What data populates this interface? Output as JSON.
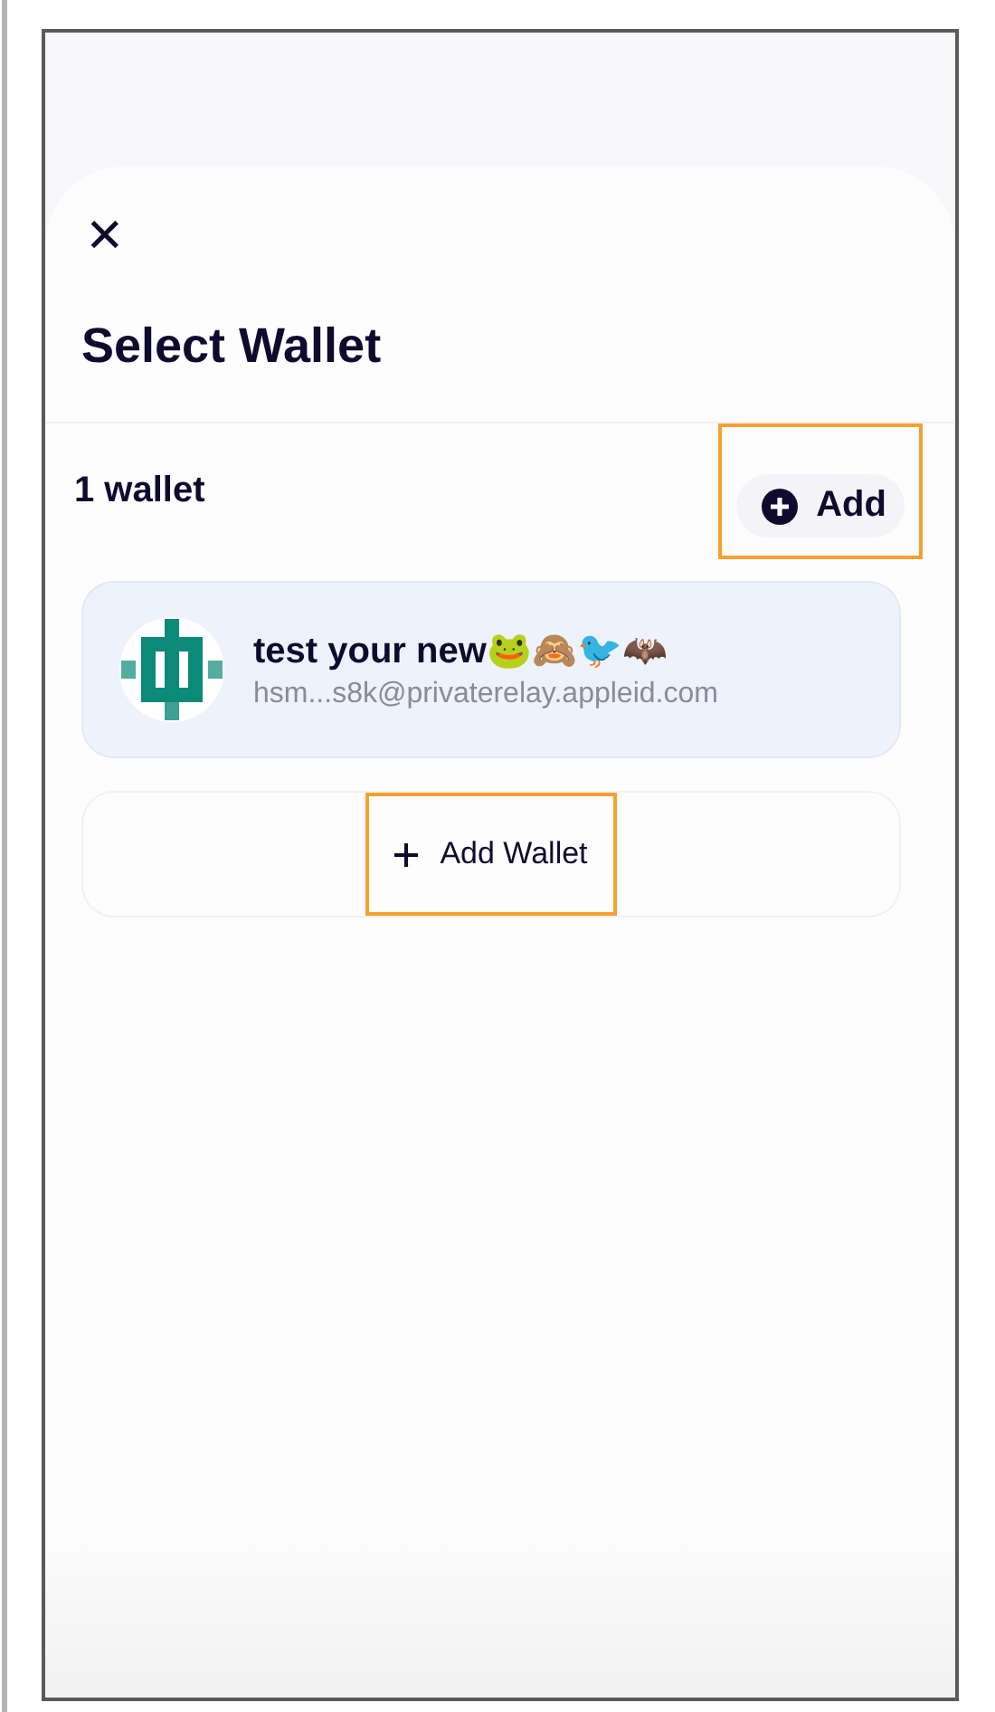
{
  "title": "Select Wallet",
  "close": {
    "label": "✕"
  },
  "count": "1 wallet",
  "add_button": {
    "label": "Add",
    "highlighted": true
  },
  "wallets": [
    {
      "name": "test your new🐸🙈🐦🦇",
      "email": "hsm...s8k@privaterelay.appleid.com",
      "selected": true
    }
  ],
  "add_wallet_button": {
    "label": "Add Wallet",
    "highlighted": true
  }
}
